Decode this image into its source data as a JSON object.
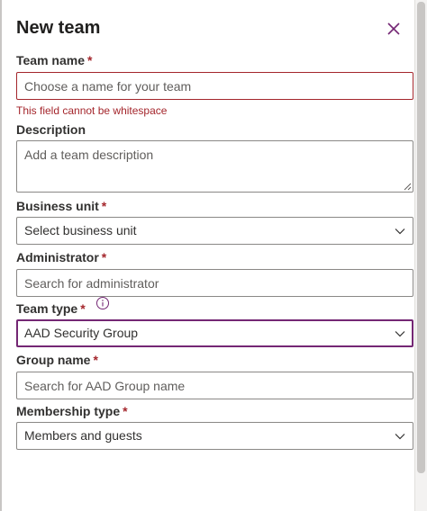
{
  "panel": {
    "title": "New team"
  },
  "fields": {
    "team_name": {
      "label": "Team name",
      "required": "*",
      "placeholder": "Choose a name for your team",
      "error": "This field cannot be whitespace"
    },
    "description": {
      "label": "Description",
      "placeholder": "Add a team description"
    },
    "business_unit": {
      "label": "Business unit",
      "required": "*",
      "value": "Select business unit"
    },
    "administrator": {
      "label": "Administrator",
      "required": "*",
      "placeholder": "Search for administrator"
    },
    "team_type": {
      "label": "Team type",
      "required": "*",
      "value": "AAD Security Group"
    },
    "group_name": {
      "label": "Group name",
      "required": "*",
      "placeholder": "Search for AAD Group name"
    },
    "membership_type": {
      "label": "Membership type",
      "required": "*",
      "value": "Members and guests"
    }
  },
  "icons": {
    "close": "close-icon",
    "chevron": "chevron-down-icon",
    "info": "info-icon"
  },
  "colors": {
    "accent": "#742774",
    "error": "#a4262c",
    "border": "#8a8886",
    "text": "#323130"
  }
}
